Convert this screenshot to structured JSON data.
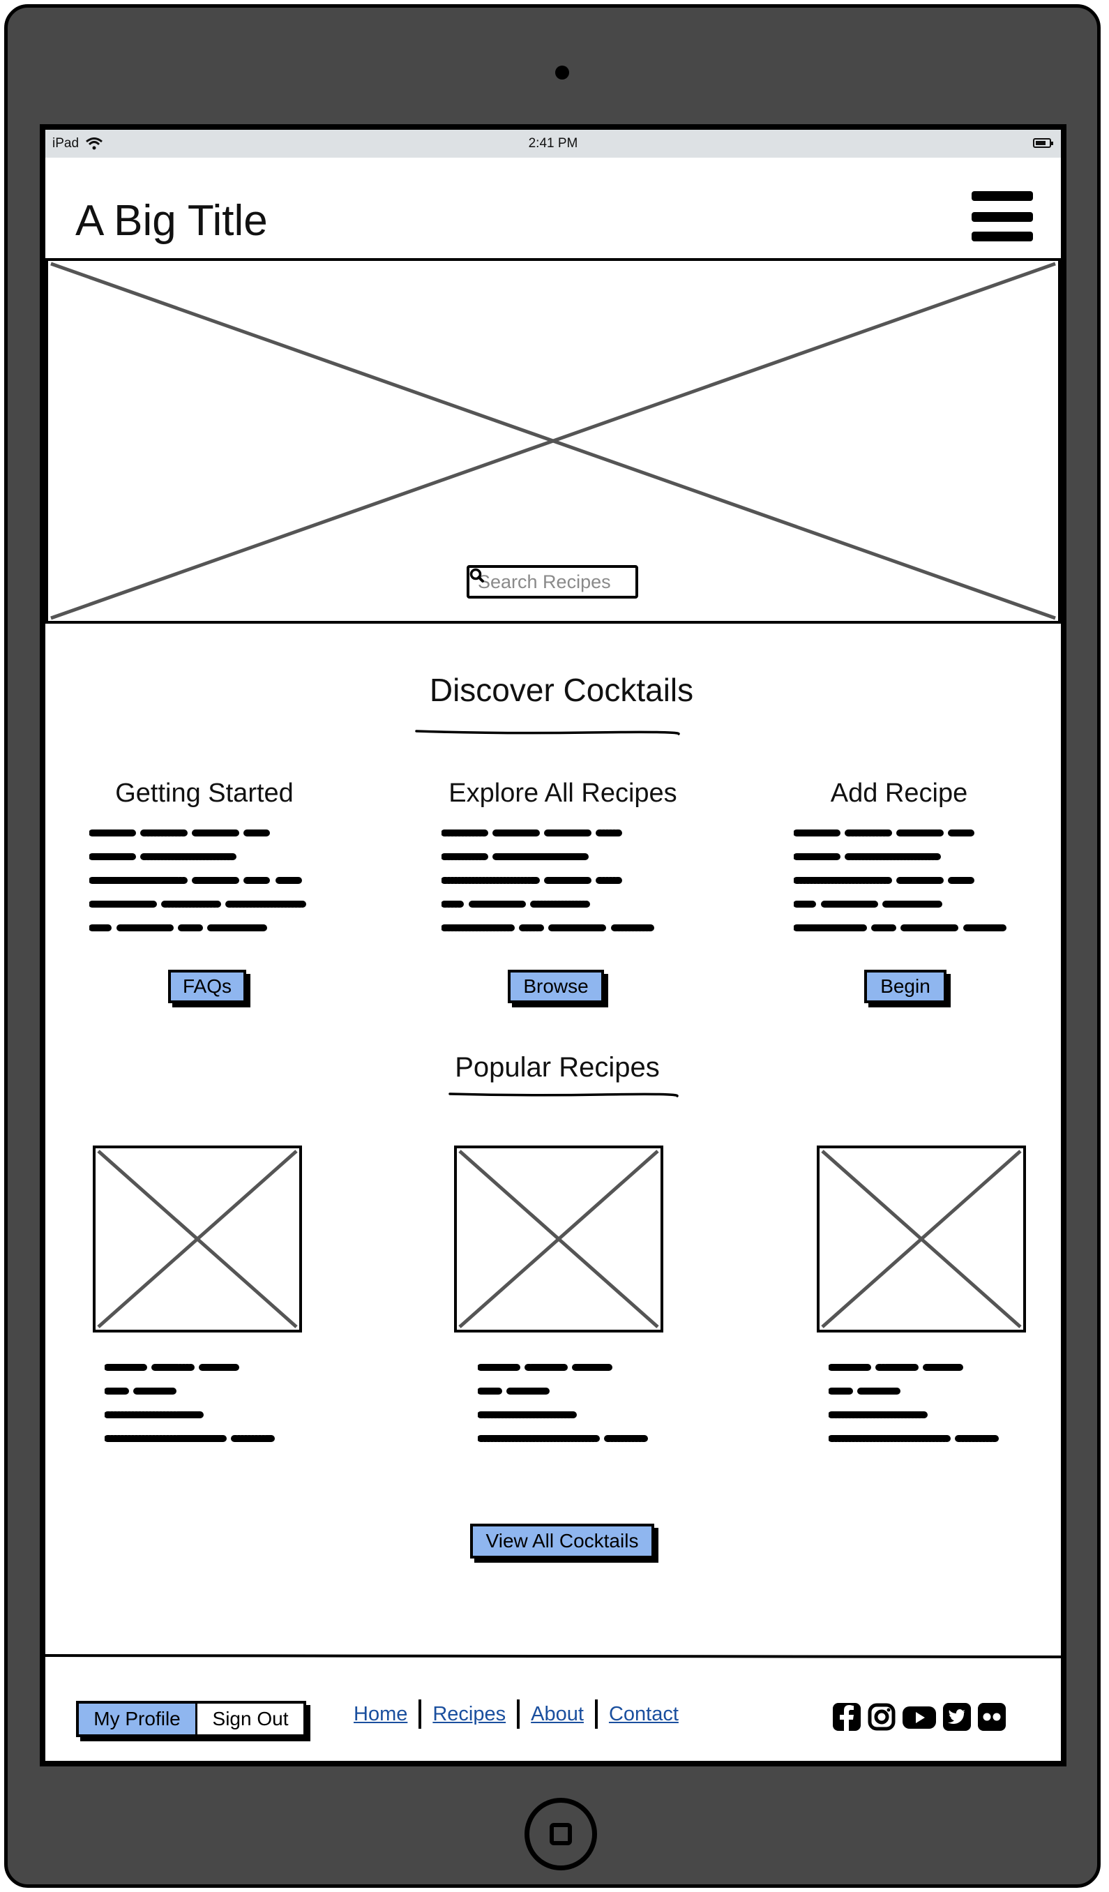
{
  "status_bar": {
    "device": "iPad",
    "time": "2:41 PM"
  },
  "header": {
    "title": "A Big Title"
  },
  "hero": {
    "search_placeholder": "Search Recipes"
  },
  "discover": {
    "title": "Discover Cocktails",
    "columns": [
      {
        "title": "Getting Started",
        "button": "FAQs"
      },
      {
        "title": "Explore All Recipes",
        "button": "Browse"
      },
      {
        "title": "Add Recipe",
        "button": "Begin"
      }
    ]
  },
  "popular": {
    "title": "Popular Recipes",
    "button": "View All Cocktails"
  },
  "footer": {
    "profile_label": "My Profile",
    "signout_label": "Sign Out",
    "nav": [
      "Home",
      "Recipes",
      "About",
      "Contact"
    ],
    "socials": [
      "facebook-icon",
      "instagram-icon",
      "youtube-icon",
      "twitter-icon",
      "flickr-icon"
    ]
  },
  "colors": {
    "accent": "#8fb6ef",
    "device": "#484848",
    "status_bar": "#dde1e4",
    "link": "#1a4f9e"
  }
}
